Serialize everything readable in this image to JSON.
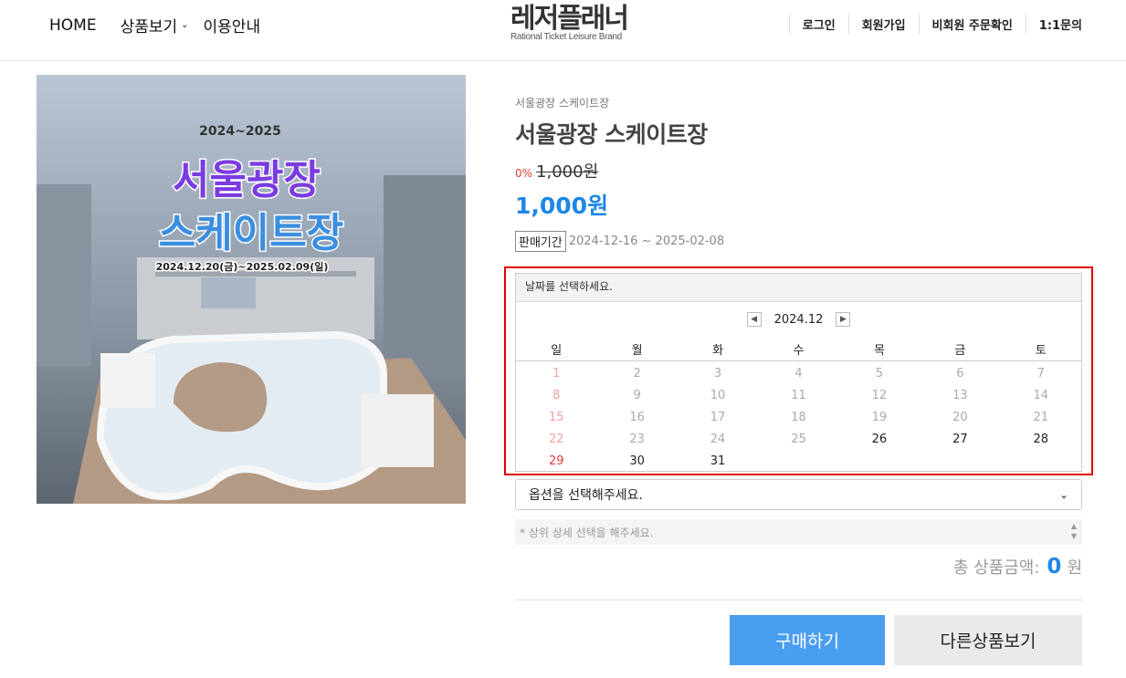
{
  "header": {
    "nav_left": [
      "HOME",
      "상품보기",
      "이용안내"
    ],
    "logo_main": "레저플래너",
    "logo_sub": "Rational Ticket Leisure Brand",
    "nav_right": [
      "로그인",
      "회원가입",
      "비회원 주문확인",
      "1:1문의"
    ]
  },
  "product_image": {
    "years": "2024~2025",
    "title_line1": "서울광장",
    "title_line2": "스케이트장",
    "dates": "2024.12.20(금)~2025.02.09(일)"
  },
  "product": {
    "breadcrumb": "서울광장 스케이트장",
    "title": "서울광장 스케이트장",
    "discount": "0%",
    "original_price": "1,000원",
    "sale_price": "1,000원",
    "period_tag": "판매기간",
    "period": "2024-12-16 ~ 2025-02-08"
  },
  "calendar": {
    "header": "날짜를 선택하세요.",
    "month": "2024.12",
    "prev_icon": "chevron-left-icon",
    "next_icon": "chevron-right-icon",
    "weekdays": [
      "일",
      "월",
      "화",
      "수",
      "목",
      "금",
      "토"
    ],
    "first_weekday_index": 0,
    "days_in_month": 31,
    "first_available_day": 26
  },
  "options": {
    "select_placeholder": "옵션을 선택해주세요.",
    "sub_option_placeholder": "* 상위 상세 선택을 해주세요."
  },
  "total": {
    "label": "총 상품금액:",
    "amount": "0",
    "unit": "원"
  },
  "buttons": {
    "buy": "구매하기",
    "other": "다른상품보기"
  },
  "colors": {
    "accent": "#1e88e5",
    "buy_button": "#4a9ef0",
    "highlight": "#e00000",
    "sunday": "#e53935"
  }
}
